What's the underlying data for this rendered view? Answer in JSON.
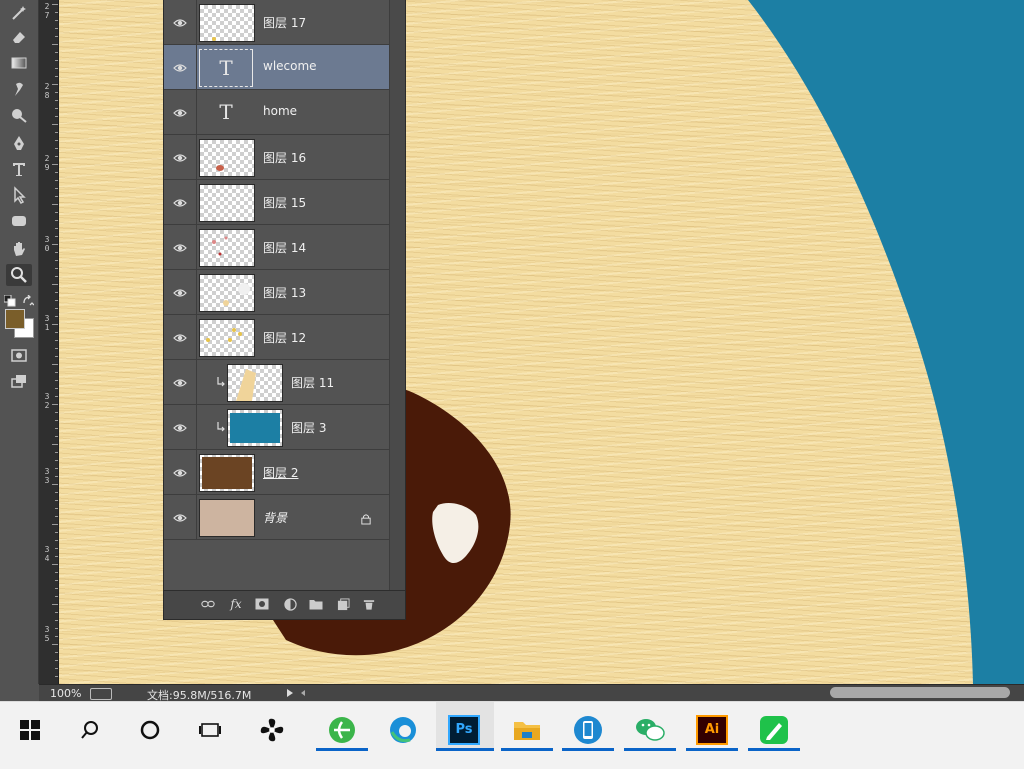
{
  "toolbar": {
    "tools": [
      "magic-wand",
      "eraser",
      "gradient",
      "smudge",
      "dodge",
      "pen",
      "type",
      "path-selection",
      "rectangle",
      "hand",
      "zoom"
    ],
    "active_tool": "zoom",
    "foreground_color": "#7a5e2a",
    "background_color": "#ffffff"
  },
  "ruler": {
    "labels": [
      {
        "text": "2\n7"
      },
      {
        "text": "2\n8"
      },
      {
        "text": "2\n9"
      },
      {
        "text": "3\n0"
      },
      {
        "text": "3\n1"
      },
      {
        "text": "3\n2"
      },
      {
        "text": "3\n3"
      },
      {
        "text": "3\n4"
      },
      {
        "text": "3\n5"
      }
    ]
  },
  "canvas": {
    "background_color": "#f3dca0",
    "ocean_color": "#1c7fa4",
    "hole_color": "#4a1a08",
    "stone_color": "#f5efe6"
  },
  "layers_panel": {
    "layers": [
      {
        "name": "图层 17",
        "kind": "pixel",
        "selected": false,
        "clipped": false
      },
      {
        "name": "wlecome",
        "kind": "text",
        "selected": true,
        "clipped": false
      },
      {
        "name": "home",
        "kind": "text",
        "selected": false,
        "clipped": false
      },
      {
        "name": "图层 16",
        "kind": "pixel",
        "selected": false,
        "clipped": false
      },
      {
        "name": "图层 15",
        "kind": "pixel",
        "selected": false,
        "clipped": false
      },
      {
        "name": "图层 14",
        "kind": "pixel",
        "selected": false,
        "clipped": false
      },
      {
        "name": "图层 13",
        "kind": "pixel",
        "selected": false,
        "clipped": false
      },
      {
        "name": "图层 12",
        "kind": "pixel",
        "selected": false,
        "clipped": false
      },
      {
        "name": "图层 11",
        "kind": "pixel",
        "selected": false,
        "clipped": true
      },
      {
        "name": "图层 3",
        "kind": "pixel",
        "selected": false,
        "clipped": true
      },
      {
        "name": "图层 2",
        "kind": "pixel",
        "selected": false,
        "clipped": false
      },
      {
        "name": "背景",
        "kind": "background",
        "selected": false,
        "clipped": false,
        "locked": true
      }
    ],
    "footer_buttons": [
      "link-layers",
      "fx",
      "add-mask",
      "adjustment-layer",
      "new-group",
      "new-layer",
      "delete-layer"
    ],
    "fx_label": "fx",
    "type_glyph": "T"
  },
  "status_bar": {
    "zoom": "100%",
    "doc_info": "文档:95.8M/516.7M"
  },
  "taskbar": {
    "items": [
      "start",
      "search",
      "cortana",
      "task-view",
      "pinwheel-app",
      "360-browser",
      "edge",
      "photoshop",
      "file-explorer",
      "phone-app",
      "wechat",
      "illustrator",
      "green-app"
    ],
    "active": "photoshop",
    "ps_label": "Ps",
    "ai_label": "Ai"
  }
}
